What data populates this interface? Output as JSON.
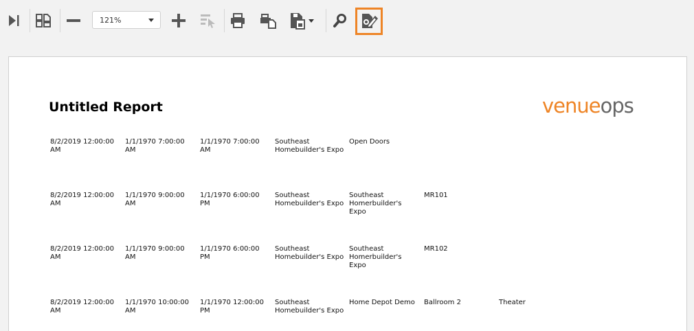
{
  "toolbar": {
    "zoom": "121%",
    "buttons": [
      {
        "id": "last-page",
        "icon": "skip-to-end-icon"
      },
      {
        "id": "multi-page",
        "icon": "multi-page-icon"
      },
      {
        "id": "zoom-out",
        "icon": "minus-icon"
      },
      {
        "id": "zoom-in",
        "icon": "plus-icon"
      },
      {
        "id": "select-tool",
        "icon": "select-cursor-icon"
      },
      {
        "id": "print",
        "icon": "printer-icon"
      },
      {
        "id": "print-page",
        "icon": "print-page-icon"
      },
      {
        "id": "export",
        "icon": "export-save-icon"
      },
      {
        "id": "search",
        "icon": "search-icon"
      },
      {
        "id": "edit-report",
        "icon": "edit-report-icon"
      }
    ],
    "highlight_color": "#ee8425"
  },
  "report": {
    "title": "Untitled Report",
    "logo_part1": "venue",
    "logo_part2": "ops",
    "brand_color": "#ee8425",
    "rows": [
      [
        "8/2/2019 12:00:00 AM",
        "1/1/1970 7:00:00 AM",
        "1/1/1970 7:00:00 AM",
        "Southeast Homebuilder's Expo",
        "Open Doors",
        "",
        ""
      ],
      [
        "8/2/2019 12:00:00 AM",
        "1/1/1970 9:00:00 AM",
        "1/1/1970 6:00:00 PM",
        "Southeast Homebuilder's Expo",
        "Southeast Homerbuilder's Expo",
        "MR101",
        ""
      ],
      [
        "8/2/2019 12:00:00 AM",
        "1/1/1970 9:00:00 AM",
        "1/1/1970 6:00:00 PM",
        "Southeast Homebuilder's Expo",
        "Southeast Homerbuilder's Expo",
        "MR102",
        ""
      ],
      [
        "8/2/2019 12:00:00 AM",
        "1/1/1970 10:00:00 AM",
        "1/1/1970 12:00:00 PM",
        "Southeast Homebuilder's Expo",
        "Home Depot Demo",
        "Ballroom 2",
        "Theater"
      ]
    ]
  }
}
